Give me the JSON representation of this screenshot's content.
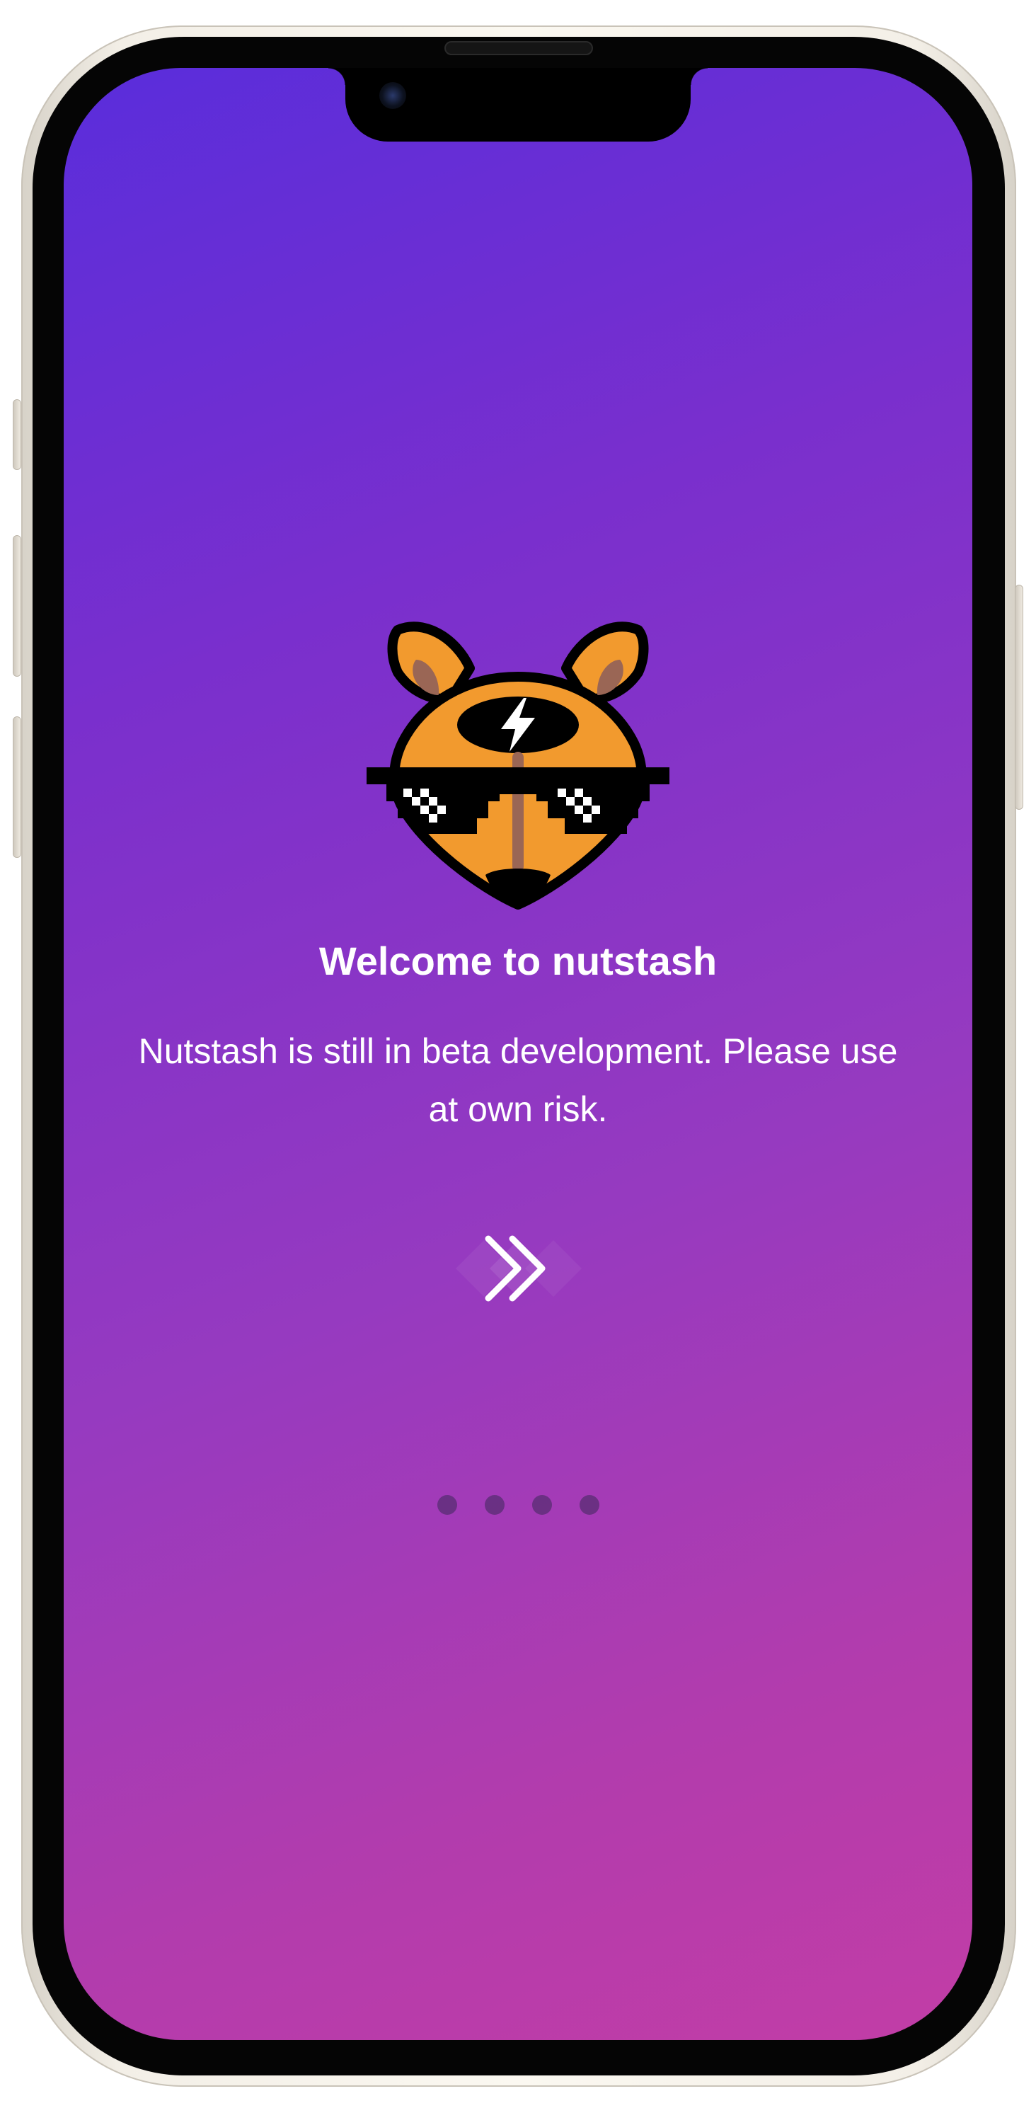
{
  "welcome": {
    "title": "Welcome to nutstash",
    "message": "Nutstash is still in beta development. Please use at own risk."
  },
  "logo": {
    "icon": "squirrel-with-sunglasses-logo",
    "lightning_icon": "lightning-bolt-icon"
  },
  "next_button": {
    "icon": "chevron-double-right-icon"
  },
  "pagination": {
    "pages": 4,
    "current": 1
  },
  "colors": {
    "gradient_start": "#5a2ddb",
    "gradient_end": "#c23da6",
    "fox_orange": "#f29a2e",
    "text": "#ffffff"
  }
}
